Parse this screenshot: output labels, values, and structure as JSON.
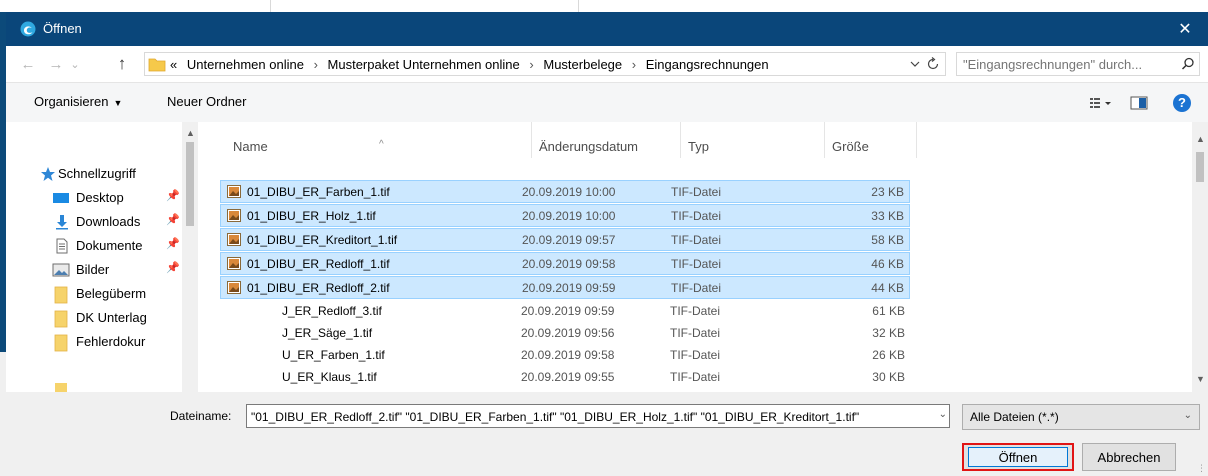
{
  "window": {
    "title": "Öffnen",
    "close_glyph": "✕"
  },
  "colors": {
    "titlebar": "#0a467a",
    "selection_bg": "#cce8ff",
    "selection_border": "#99d1ff",
    "accent_red": "#e11414",
    "help_blue": "#1b73d2"
  },
  "nav": {
    "back_glyph": "←",
    "forward_glyph": "→",
    "recent_glyph": "⌄",
    "up_glyph": "↑"
  },
  "address": {
    "overflow": "«",
    "separator": "›",
    "crumbs": [
      "Unternehmen online",
      "Musterpaket Unternehmen online",
      "Musterbelege",
      "Eingangsrechnungen"
    ]
  },
  "search": {
    "placeholder": "\"Eingangsrechnungen\" durch..."
  },
  "toolbar": {
    "organize_label": "Organisieren",
    "organize_caret": "▼",
    "new_folder_label": "Neuer Ordner",
    "help_label": "?"
  },
  "sidebar": {
    "items": [
      {
        "label": "Schnellzugriff",
        "icon": "star-icon",
        "pinned": false
      },
      {
        "label": "Desktop",
        "icon": "desktop-icon",
        "pinned": true
      },
      {
        "label": "Downloads",
        "icon": "download-icon",
        "pinned": true
      },
      {
        "label": "Dokumente",
        "icon": "document-icon",
        "pinned": true
      },
      {
        "label": "Bilder",
        "icon": "pictures-icon",
        "pinned": true
      },
      {
        "label": "Belegüberm",
        "icon": "folder-icon",
        "pinned": false
      },
      {
        "label": "DK Unterlag",
        "icon": "folder-icon",
        "pinned": false
      },
      {
        "label": "Fehlerdokur",
        "icon": "folder-icon",
        "pinned": false
      }
    ]
  },
  "columns": {
    "name": "Name",
    "date": "Änderungsdatum",
    "type": "Typ",
    "size": "Größe",
    "sort_glyph": "^"
  },
  "files": [
    {
      "name": "01_DIBU_ER_Farben_1.tif",
      "date": "20.09.2019 10:00",
      "type": "TIF-Datei",
      "size": "23 KB",
      "selected": true
    },
    {
      "name": "01_DIBU_ER_Holz_1.tif",
      "date": "20.09.2019 10:00",
      "type": "TIF-Datei",
      "size": "33 KB",
      "selected": true
    },
    {
      "name": "01_DIBU_ER_Kreditort_1.tif",
      "date": "20.09.2019 09:57",
      "type": "TIF-Datei",
      "size": "58 KB",
      "selected": true
    },
    {
      "name": "01_DIBU_ER_Redloff_1.tif",
      "date": "20.09.2019 09:58",
      "type": "TIF-Datei",
      "size": "46 KB",
      "selected": true
    },
    {
      "name": "01_DIBU_ER_Redloff_2.tif",
      "date": "20.09.2019 09:59",
      "type": "TIF-Datei",
      "size": "44 KB",
      "selected": true
    },
    {
      "name": "J_ER_Redloff_3.tif",
      "date": "20.09.2019 09:59",
      "type": "TIF-Datei",
      "size": "61 KB",
      "selected": false
    },
    {
      "name": "J_ER_Säge_1.tif",
      "date": "20.09.2019 09:56",
      "type": "TIF-Datei",
      "size": "32 KB",
      "selected": false
    },
    {
      "name": "U_ER_Farben_1.tif",
      "date": "20.09.2019 09:58",
      "type": "TIF-Datei",
      "size": "26 KB",
      "selected": false
    },
    {
      "name": "U_ER_Klaus_1.tif",
      "date": "20.09.2019 09:55",
      "type": "TIF-Datei",
      "size": "30 KB",
      "selected": false
    }
  ],
  "footer": {
    "filename_label": "Dateiname:",
    "filename_value": "\"01_DIBU_ER_Redloff_2.tif\" \"01_DIBU_ER_Farben_1.tif\" \"01_DIBU_ER_Holz_1.tif\" \"01_DIBU_ER_Kreditort_1.tif\"",
    "filter_value": "Alle Dateien (*.*)",
    "open_label": "Öffnen",
    "cancel_label": "Abbrechen"
  }
}
